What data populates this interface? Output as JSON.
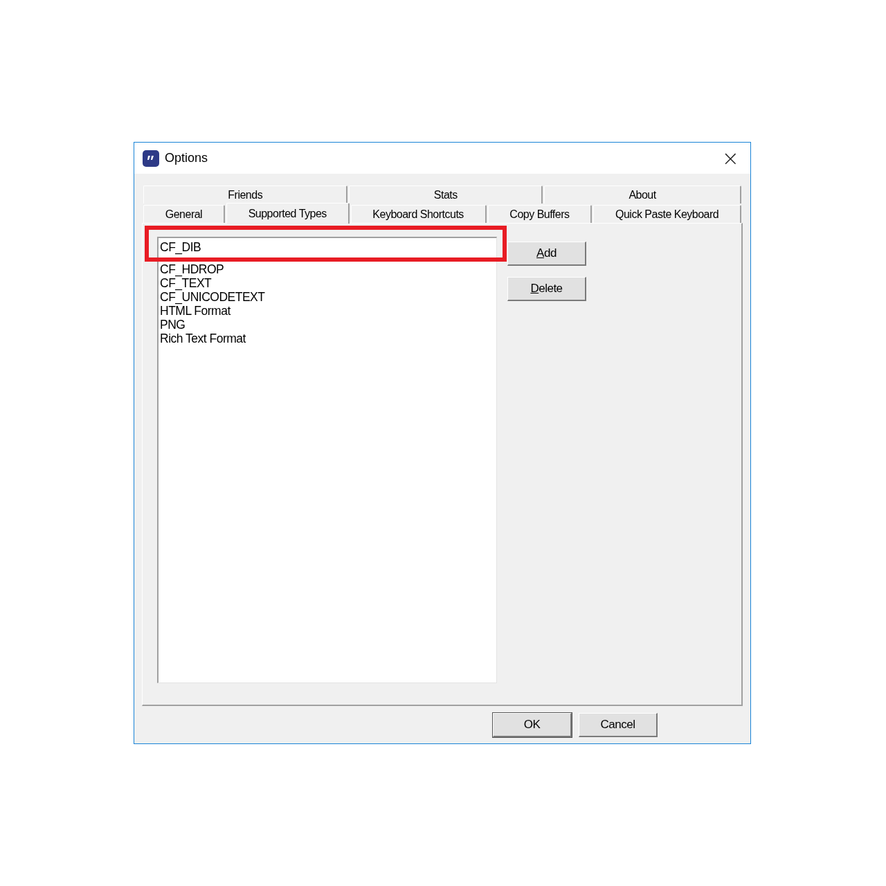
{
  "window": {
    "title": "Options",
    "close": "×"
  },
  "tab_rows": [
    {
      "tabs": [
        {
          "label": "Friends",
          "selected": false
        },
        {
          "label": "Stats",
          "selected": false
        },
        {
          "label": "About",
          "selected": false
        }
      ]
    },
    {
      "tabs": [
        {
          "label": "General",
          "selected": false
        },
        {
          "label": "Supported Types",
          "selected": true
        },
        {
          "label": "Keyboard Shortcuts",
          "selected": false
        },
        {
          "label": "Copy Buffers",
          "selected": false
        },
        {
          "label": "Quick Paste Keyboard",
          "selected": false
        }
      ]
    }
  ],
  "types_list": {
    "items": [
      {
        "label": "CF_DIB",
        "selected": false
      },
      {
        "label": "CF_HDROP",
        "selected": false
      },
      {
        "label": "CF_TEXT",
        "selected": false
      },
      {
        "label": "CF_UNICODETEXT",
        "selected": false
      },
      {
        "label": "HTML Format",
        "selected": false
      },
      {
        "label": "PNG",
        "selected": false
      },
      {
        "label": "Rich Text Format",
        "selected": false
      }
    ]
  },
  "side_buttons": [
    {
      "mnemonic": "A",
      "rest": "dd"
    },
    {
      "mnemonic": "D",
      "rest": "elete"
    }
  ],
  "highlight": true,
  "footer_buttons": [
    {
      "label": "OK",
      "default": true
    },
    {
      "label": "Cancel",
      "default": false
    }
  ]
}
